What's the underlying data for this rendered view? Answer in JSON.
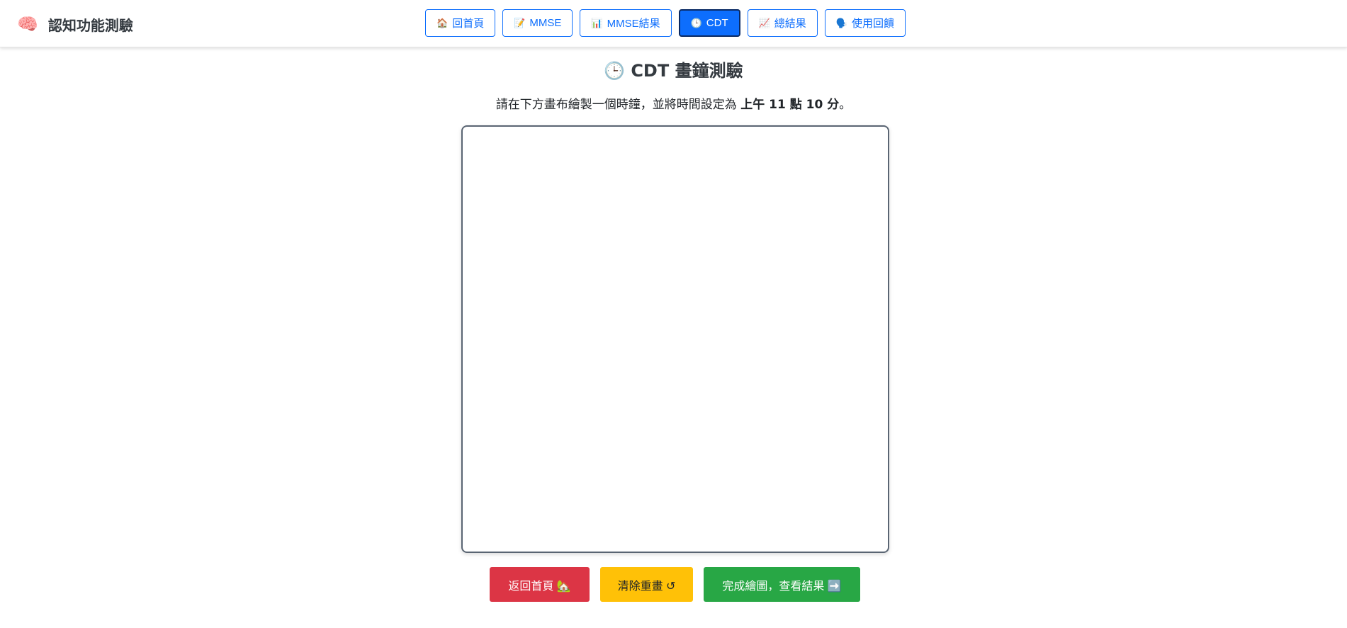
{
  "app": {
    "brand_icon": "🧠",
    "brand_title": "認知功能測驗"
  },
  "nav": {
    "items": [
      {
        "icon": "🏠",
        "label": "回首頁",
        "icon_name": "home-icon"
      },
      {
        "icon": "📝",
        "label": "MMSE",
        "icon_name": "memo-icon"
      },
      {
        "icon": "📊",
        "label": "MMSE結果",
        "icon_name": "bar-chart-icon"
      },
      {
        "icon": "🕒",
        "label": "CDT",
        "icon_name": "clock-icon",
        "active": true
      },
      {
        "icon": "📈",
        "label": "總結果",
        "icon_name": "trend-chart-icon"
      },
      {
        "icon": "🗣️",
        "label": "使用回饋",
        "icon_name": "speaking-head-icon"
      }
    ]
  },
  "page": {
    "title_icon": "🕒",
    "title": "CDT 畫鐘測驗",
    "instruction_prefix": "請在下方畫布繪製一個時鐘，並將時間設定為 ",
    "instruction_time": "上午 11 點 10 分",
    "instruction_suffix": "。"
  },
  "actions": {
    "home_label": "返回首頁 🏡",
    "clear_label": "清除重畫 ↺",
    "finish_label": "完成繪圖，查看結果 ➡️"
  },
  "colors": {
    "primary": "#0d6efd",
    "danger": "#dc3545",
    "warning": "#ffc107",
    "success": "#28a745"
  }
}
